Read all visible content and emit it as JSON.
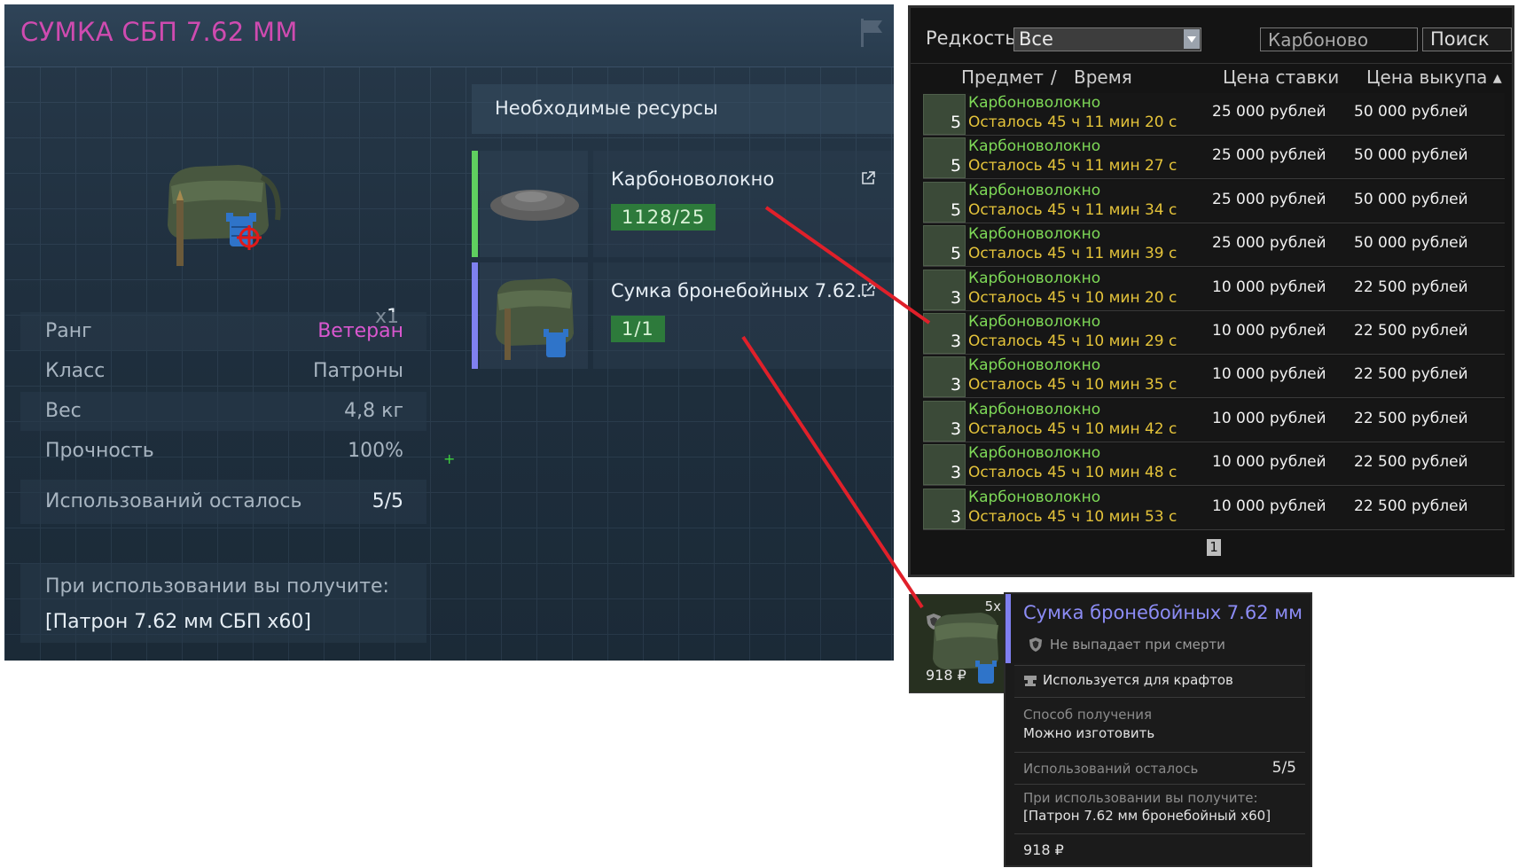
{
  "craft": {
    "title": "СУМКА СБП 7.62 ММ",
    "quantity": "x1",
    "stats": [
      {
        "label": "Ранг",
        "value": "Ветеран",
        "value_color": "#d957cf"
      },
      {
        "label": "Класс",
        "value": "Патроны",
        "value_color": "#a7b4c0"
      },
      {
        "label": "Вес",
        "value": "4,8 кг",
        "value_color": "#a7b4c0"
      },
      {
        "label": "Прочность",
        "value": "100%",
        "value_color": "#a7b4c0"
      }
    ],
    "uses_label": "Использований осталось",
    "uses_value": "5/5",
    "yield_label": "При использовании вы получите:",
    "yield_value": "[Патрон 7.62 мм СБП х60]",
    "resources_header": "Необходимые ресурсы",
    "resources": [
      {
        "name": "Карбоноволокно",
        "count": "1128/25",
        "accent": "#5fcf5f"
      },
      {
        "name": "Сумка бронебойных 7.62..",
        "count": "1/1",
        "accent": "#7f80ef"
      }
    ]
  },
  "auction": {
    "rarity_label": "Редкость",
    "rarity_value": "Все",
    "search_value": "Карбоново",
    "search_button": "Поиск",
    "columns": {
      "item": "Предмет",
      "sep": "/",
      "time": "Время",
      "bid": "Цена ставки",
      "buyout": "Цена выкупа ▴"
    },
    "rows": [
      {
        "qty": "5",
        "name": "Карбоноволокно",
        "time": "Осталось 45 ч 11 мин 20 с",
        "bid": "25 000 рублей",
        "buyout": "50 000 рублей"
      },
      {
        "qty": "5",
        "name": "Карбоноволокно",
        "time": "Осталось 45 ч 11 мин 27 с",
        "bid": "25 000 рублей",
        "buyout": "50 000 рублей"
      },
      {
        "qty": "5",
        "name": "Карбоноволокно",
        "time": "Осталось 45 ч 11 мин 34 с",
        "bid": "25 000 рублей",
        "buyout": "50 000 рублей"
      },
      {
        "qty": "5",
        "name": "Карбоноволокно",
        "time": "Осталось 45 ч 11 мин 39 с",
        "bid": "25 000 рублей",
        "buyout": "50 000 рублей"
      },
      {
        "qty": "3",
        "name": "Карбоноволокно",
        "time": "Осталось 45 ч 10 мин 20 с",
        "bid": "10 000 рублей",
        "buyout": "22 500 рублей"
      },
      {
        "qty": "3",
        "name": "Карбоноволокно",
        "time": "Осталось 45 ч 10 мин 29 с",
        "bid": "10 000 рублей",
        "buyout": "22 500 рублей"
      },
      {
        "qty": "3",
        "name": "Карбоноволокно",
        "time": "Осталось 45 ч 10 мин 35 с",
        "bid": "10 000 рублей",
        "buyout": "22 500 рублей"
      },
      {
        "qty": "3",
        "name": "Карбоноволокно",
        "time": "Осталось 45 ч 10 мин 42 с",
        "bid": "10 000 рублей",
        "buyout": "22 500 рублей"
      },
      {
        "qty": "3",
        "name": "Карбоноволокно",
        "time": "Осталось 45 ч 10 мин 48 с",
        "bid": "10 000 рублей",
        "buyout": "22 500 рублей"
      },
      {
        "qty": "3",
        "name": "Карбоноволокно",
        "time": "Осталось 45 ч 10 мин 53 с",
        "bid": "10 000 рублей",
        "buyout": "22 500 рублей"
      }
    ],
    "page": "1"
  },
  "tooltip": {
    "slot_qty": "5x",
    "slot_price": "918 ₽",
    "title": "Сумка бронебойных 7.62 мм",
    "drop_note": "Не выпадает при смерти",
    "craft_use": "Используется для крафтов",
    "source_label": "Способ получения",
    "source_value": "Можно изготовить",
    "uses_label": "Использований осталось",
    "uses_value": "5/5",
    "yield_label": "При использовании вы получите:",
    "yield_value": "[Патрон 7.62 мм бронебойный х60]",
    "price": "918 ₽"
  },
  "colors": {
    "arrow": "#e0202a",
    "title_pink": "#cf4bb0",
    "green_badge": "#2d7a3b",
    "purple_accent": "#7f80ef"
  }
}
